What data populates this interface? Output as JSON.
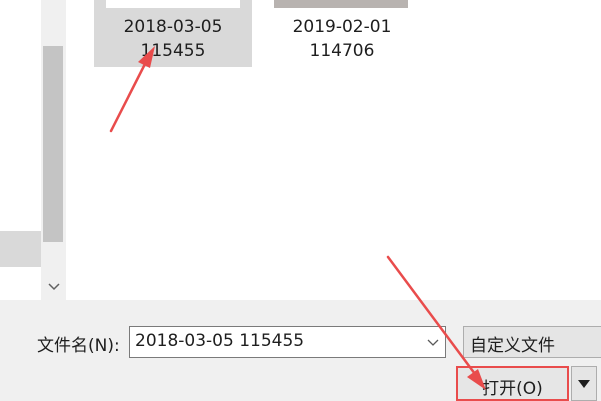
{
  "files": [
    {
      "date": "2018-03-05",
      "number": "115455",
      "selected": true
    },
    {
      "date": "2019-02-01",
      "number": "114706",
      "selected": false
    }
  ],
  "bottom": {
    "filename_label": "文件名(N):",
    "filename_value": "2018-03-05 115455",
    "filetype_value": "自定义文件",
    "open_label": "打开(O)"
  },
  "icons": {
    "scroll_down": "chevron-down-icon",
    "filename_dropdown": "chevron-down-icon",
    "open_split": "triangle-down-icon"
  },
  "colors": {
    "selection_bg": "#d9d9d9",
    "panel_bg": "#f0f0f0",
    "annotation_red": "#e94c4c"
  }
}
